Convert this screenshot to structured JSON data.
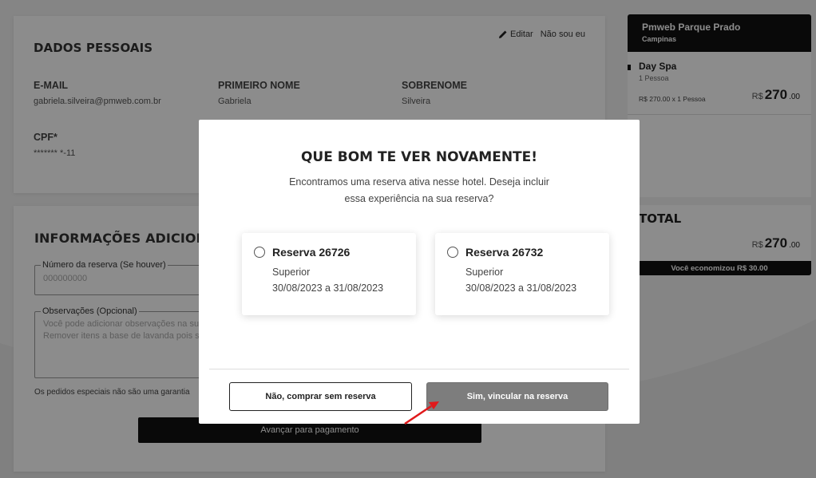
{
  "personal": {
    "title": "DADOS PESSOAIS",
    "edit_label": "Editar",
    "not_me_label": "Não sou eu",
    "email_label": "E-MAIL",
    "email_value": "gabriela.silveira@pmweb.com.br",
    "first_name_label": "PRIMEIRO NOME",
    "first_name_value": "Gabriela",
    "last_name_label": "SOBRENOME",
    "last_name_value": "Silveira",
    "cpf_label": "CPF*",
    "cpf_value": "******* *-11"
  },
  "additional": {
    "title": "INFORMAÇÕES ADICIONAIS",
    "reservation_label": "Número da reserva (Se houver)",
    "reservation_placeholder": "000000000",
    "notes_label": "Observações (Opcional)",
    "notes_placeholder_1": "Você pode adicionar observações na sua",
    "notes_placeholder_2": "Remover itens a base de lavanda pois so",
    "special_note": "Os pedidos especiais não são uma garantia",
    "advance_button": "Avançar para pagamento"
  },
  "summary": {
    "hotel": "Pmweb Parque Prado",
    "city": "Campinas",
    "item_title": "Day Spa",
    "item_qty": "1 Pessoa",
    "item_calc": "R$ 270.00 x 1 Pessoa",
    "item_currency": "R$",
    "item_price": "270",
    "item_cents": ".00",
    "total_label": "TOTAL",
    "total_currency": "R$",
    "total_price": "270",
    "total_cents": ".00",
    "savings": "Você economizou R$ 30.00"
  },
  "modal": {
    "title": "QUE BOM TE VER NOVAMENTE!",
    "text_line1": "Encontramos uma reserva ativa nesse hotel. Deseja incluir",
    "text_line2": "essa experiência na sua reserva?",
    "reservations": [
      {
        "title": "Reserva 26726",
        "room": "Superior",
        "dates": "30/08/2023 a 31/08/2023"
      },
      {
        "title": "Reserva 26732",
        "room": "Superior",
        "dates": "30/08/2023 a 31/08/2023"
      }
    ],
    "no_button": "Não, comprar sem reserva",
    "yes_button": "Sim, vincular na reserva"
  },
  "colors": {
    "arrow": "#e0191b",
    "yes_button_bg": "#7d7d7d",
    "dark": "#111111"
  }
}
